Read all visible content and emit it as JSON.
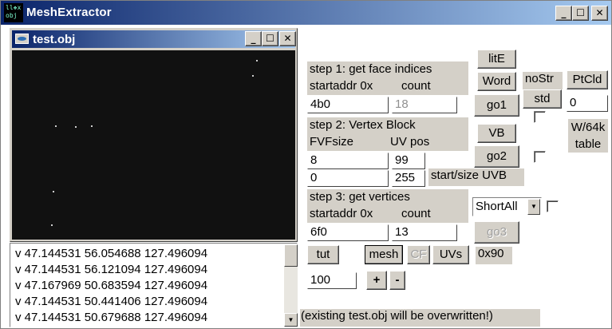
{
  "window": {
    "title": "MeshExtractor",
    "icon_text": "ll❖x obj"
  },
  "child": {
    "title": "test.obj"
  },
  "vertices": [
    "v 47.144531 56.054688 127.496094",
    "v 47.144531 56.121094 127.496094",
    "v 47.167969 50.683594 127.496094",
    "v 47.144531 50.441406 127.496094",
    "v 47.144531 50.679688 127.496094"
  ],
  "step1": {
    "heading": "step 1: get face indices",
    "startaddr_label": "startaddr 0x",
    "count_label": "count",
    "startaddr_value": "4b0",
    "count_value": "18",
    "go_label": "go1"
  },
  "step2": {
    "heading": "step 2: Vertex Block",
    "fvf_label": "FVFsize",
    "uvpos_label": "UV pos",
    "fvf_value": "8",
    "uvpos_value": "99",
    "start_value": "0",
    "size_value": "255",
    "startsize_label": "start/size UVB",
    "vb_label": "VB",
    "go_label": "go2"
  },
  "step3": {
    "heading": "step 3: get vertices",
    "startaddr_label": "startaddr 0x",
    "count_label": "count",
    "startaddr_value": "6f0",
    "count_value": "13",
    "go_label": "go3",
    "mode_value": "ShortAll"
  },
  "side": {
    "lite_label": "litE",
    "word_label": "Word",
    "nostr_label": "noStr",
    "std_label": "std",
    "ptcld_label": "PtCld",
    "ptcld_value": "0",
    "w64k_label": "W/64k",
    "table_label": "table"
  },
  "bottom": {
    "tut_label": "tut",
    "mesh_label": "mesh",
    "cf_label": "CF",
    "uvs_label": "UVs",
    "offset_text": "0x90",
    "zoom_value": "100",
    "plus_label": "+",
    "minus_label": "-",
    "warning_text": "(existing test.obj will be overwritten!)"
  }
}
